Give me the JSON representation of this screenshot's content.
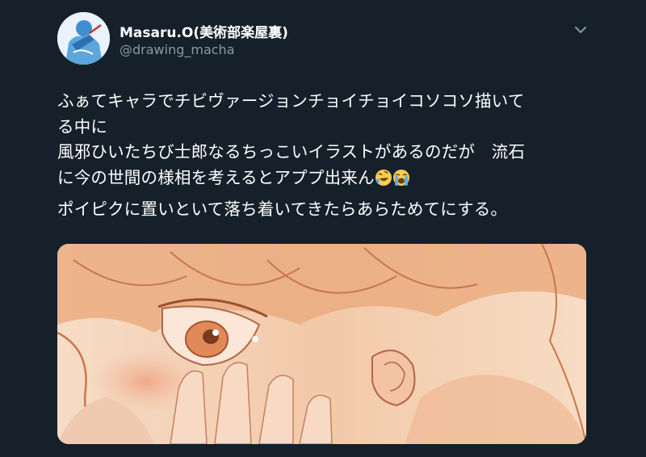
{
  "tweet": {
    "author_name": "Masaru.O(美術部楽屋裏)",
    "author_handle": "@drawing_macha",
    "menu_icon": "chevron-down-icon",
    "lines": [
      "ふぁてキャラでチビヴァージョンチョイチョイコソコソ描いて",
      "る中に",
      "風邪ひいたちび士郎なるちっこいイラストがあるのだが　流石",
      "に今の世間の様相を考えるとアププ出来ん"
    ],
    "emojis": [
      "rofl-emoji",
      "loudly-crying-emoji"
    ],
    "paragraph2": "ポイピクに置いといて落ち着いてきたらあらためてにする。"
  },
  "colors": {
    "background": "#15202b",
    "text": "#ffffff",
    "secondary_text": "#8899a6"
  }
}
